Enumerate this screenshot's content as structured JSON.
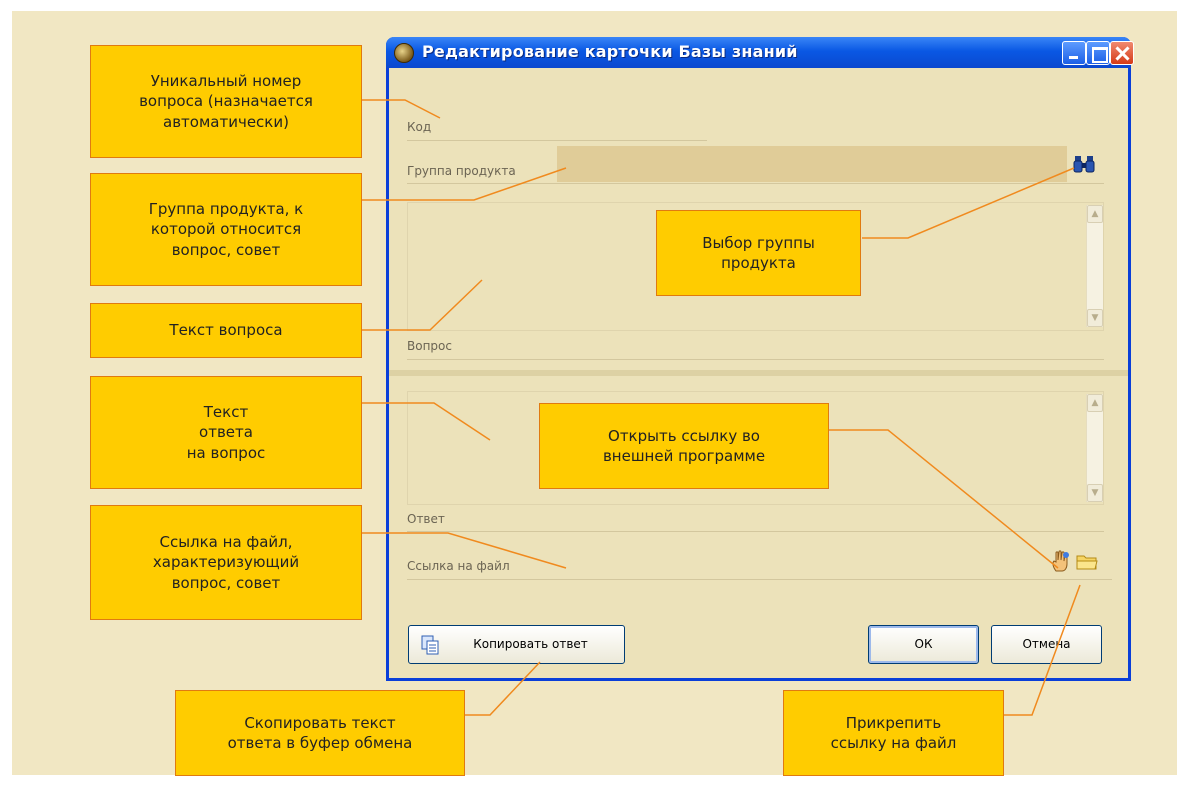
{
  "window": {
    "title": "Редактирование карточки Базы знаний",
    "title_bar_color": "#0a58e4"
  },
  "fields": {
    "code_label": "Код",
    "group_label": "Группа продукта",
    "question_label": "Вопрос",
    "answer_label": "Ответ",
    "link_label": "Ссылка на файл"
  },
  "buttons": {
    "copy_answer": "Копировать ответ",
    "ok": "ОК",
    "cancel": "Отмена"
  },
  "icons": {
    "title": "app-icon",
    "group_select": "binoculars-icon",
    "open_link": "hand-icon",
    "attach_link": "folder-icon",
    "copy": "copy-icon"
  },
  "callouts": {
    "unique_number": "Уникальный номер\nвопроса (назначается\nавтоматически)",
    "product_group": "Группа продукта, к\nкоторой относится\nвопрос, совет",
    "question_text": "Текст вопроса",
    "answer_text": "Текст\nответа\nна  вопрос",
    "file_link": "Ссылка на файл,\nхарактеризующий\nвопрос, совет",
    "select_group": "Выбор группы\nпродукта",
    "open_link": "Открыть ссылку во\nвнешней программе",
    "copy_answer": "Скопировать текст\nответа в буфер обмена",
    "attach_link": "Прикрепить\nссылку на файл"
  },
  "colors": {
    "callout_fill": "#ffcc00",
    "callout_border": "#e07a10",
    "leader_line": "#f08a1e",
    "background": "#f1e7c3",
    "dialog_body": "#ece2ba"
  }
}
